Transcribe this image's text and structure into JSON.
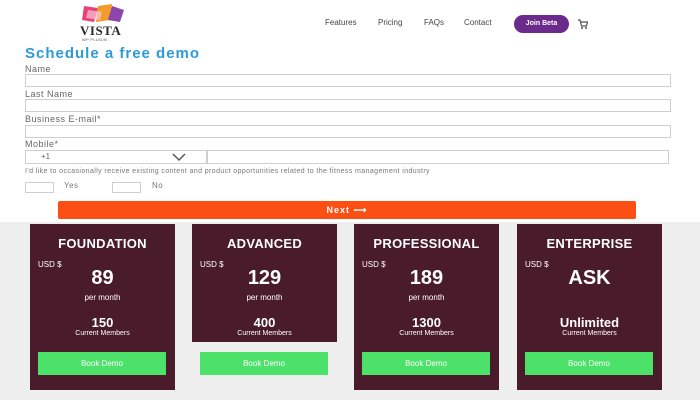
{
  "brand": {
    "name": "VISTA",
    "tagline": "WP PLUGIN"
  },
  "nav": {
    "links": [
      "Features",
      "Pricing",
      "FAQs",
      "Contact"
    ],
    "cta": "Join Beta"
  },
  "form": {
    "title": "Schedule a free demo",
    "name_label": "Name",
    "lastname_label": "Last Name",
    "email_label": "Business E-mail*",
    "mobile_label": "Mobile*",
    "country_code": "+1",
    "consent_text": "I'd like to occasionally receive existing content and product opportunities related to the fitness management industry",
    "yes_label": "Yes",
    "no_label": "No",
    "next_label": "Next  ⟶"
  },
  "plans": [
    {
      "name": "FOUNDATION",
      "currency": "USD $",
      "price": "89",
      "period": "per month",
      "members": "150",
      "members_label": "Current Members",
      "cta": "Book Demo"
    },
    {
      "name": "ADVANCED",
      "currency": "USD $",
      "price": "129",
      "period": "per month",
      "members": "400",
      "members_label": "Current Members",
      "cta": "Book Demo"
    },
    {
      "name": "PROFESSIONAL",
      "currency": "USD $",
      "price": "189",
      "period": "per month",
      "members": "1300",
      "members_label": "Current Members",
      "cta": "Book Demo"
    },
    {
      "name": "ENTERPRISE",
      "currency": "USD $",
      "price": "ASK",
      "period": "",
      "members": "Unlimited",
      "members_label": "Current Members",
      "cta": "Book Demo"
    }
  ],
  "colors": {
    "accent_title": "#2e9ad7",
    "next_button": "#fb4f14",
    "card_bg": "#4a1c2b",
    "book_button": "#4ce26a",
    "join_button": "#6b2a8c"
  }
}
